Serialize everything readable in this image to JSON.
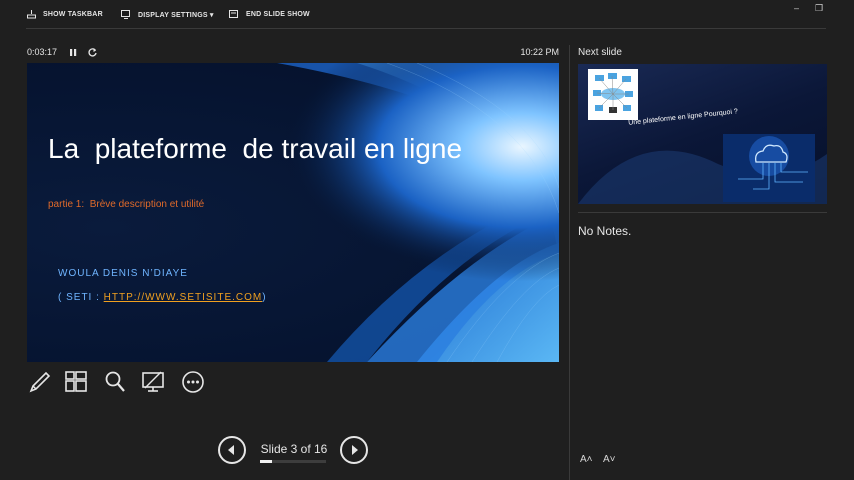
{
  "toolbar": {
    "show_taskbar": "SHOW TASKBAR",
    "display_settings": "DISPLAY SETTINGS ▾",
    "end_slide_show": "END SLIDE SHOW"
  },
  "window": {
    "minimize": "–",
    "restore": "❒"
  },
  "timer": {
    "elapsed": "0:03:17",
    "clock": "10:22 PM"
  },
  "current_slide": {
    "title": "La  plateforme  de travail en ligne",
    "subtitle": "partie 1:  Brève description et utilité",
    "author": "WOULA DENIS N’DIAYE",
    "link_prefix": "( SETI : ",
    "link": "HTTP://WWW.SETISITE.COM",
    "link_suffix": ")"
  },
  "tools": [
    "pen-icon",
    "slides-grid-icon",
    "zoom-icon",
    "black-screen-icon",
    "more-options-icon"
  ],
  "navigation": {
    "counter": "Slide 3 of 16",
    "progress": 0.1875
  },
  "next_slide": {
    "label": "Next slide",
    "text": "Une plateforme en ligne Pourquoi ?"
  },
  "notes": {
    "text": "No Notes."
  },
  "font_controls": {
    "increase": "A˄",
    "decrease": "A˅"
  },
  "colors": {
    "accent_orange": "#e06a2a",
    "link_gold": "#f0a020",
    "author_blue": "#6fb4ff"
  }
}
